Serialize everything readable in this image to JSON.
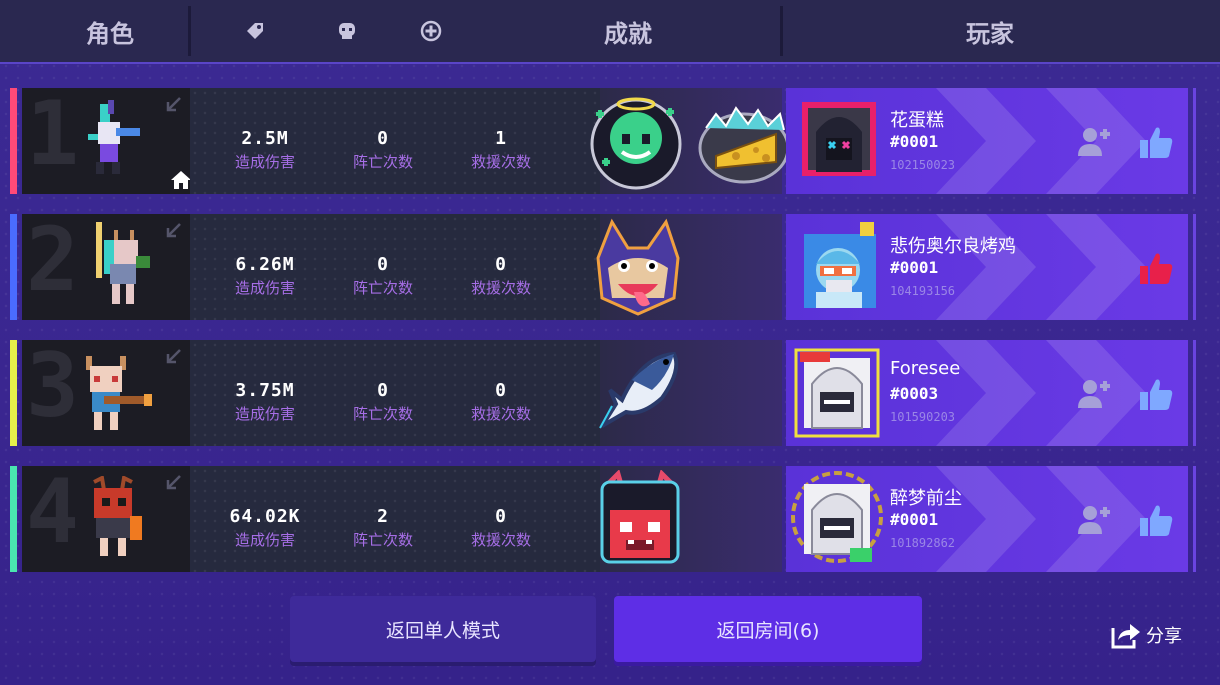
{
  "header": {
    "role_label": "角色",
    "achievement_label": "成就",
    "player_label": "玩家"
  },
  "rows": [
    {
      "rank": "1",
      "accent": "#ff4a78",
      "damage": "2.5M",
      "damage_label": "造成伤害",
      "deaths": "0",
      "deaths_label": "阵亡次数",
      "rescues": "1",
      "rescues_label": "救援次数",
      "player_name": "花蛋糕",
      "player_tag": "#0001",
      "player_id": "102150023",
      "liked": false
    },
    {
      "rank": "2",
      "accent": "#4a6cff",
      "damage": "6.26M",
      "damage_label": "造成伤害",
      "deaths": "0",
      "deaths_label": "阵亡次数",
      "rescues": "0",
      "rescues_label": "救援次数",
      "player_name": "悲伤奥尔良烤鸡",
      "player_tag": "#0001",
      "player_id": "104193156",
      "liked": true
    },
    {
      "rank": "3",
      "accent": "#e6f04a",
      "damage": "3.75M",
      "damage_label": "造成伤害",
      "deaths": "0",
      "deaths_label": "阵亡次数",
      "rescues": "0",
      "rescues_label": "救援次数",
      "player_name": "Foresee",
      "player_tag": "#0003",
      "player_id": "101590203",
      "liked": false
    },
    {
      "rank": "4",
      "accent": "#4ae6b0",
      "damage": "64.02K",
      "damage_label": "造成伤害",
      "deaths": "2",
      "deaths_label": "阵亡次数",
      "rescues": "0",
      "rescues_label": "救援次数",
      "player_name": "醉梦前尘",
      "player_tag": "#0001",
      "player_id": "101892862",
      "liked": false
    }
  ],
  "buttons": {
    "solo_label": "返回单人模式",
    "room_label": "返回房间(6)",
    "share_label": "分享"
  },
  "colors": {
    "liked": "#e8204a",
    "unliked": "#7fa8ff",
    "player_panel": "#5a32d8",
    "room_button": "#5e2ee6",
    "solo_button": "#3e2a9a"
  }
}
